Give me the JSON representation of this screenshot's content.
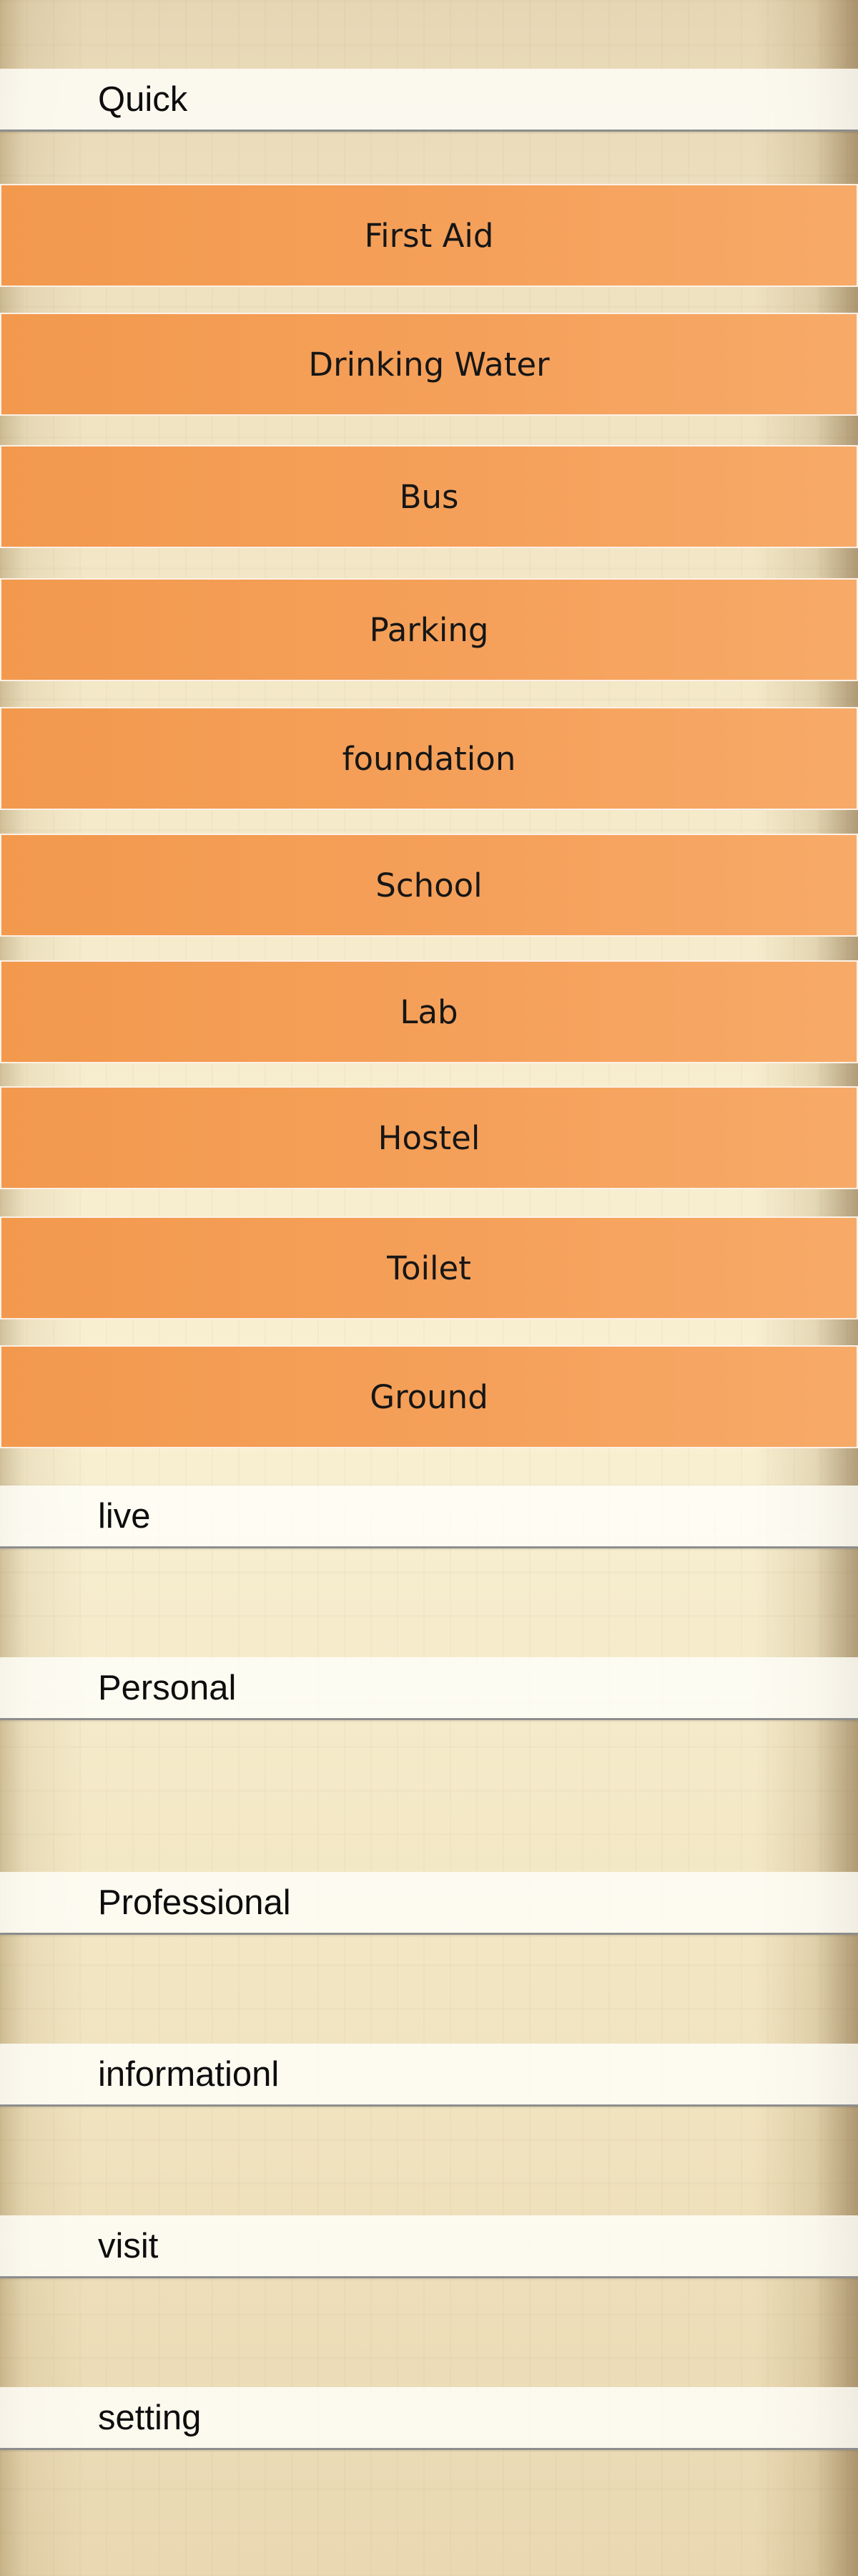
{
  "quick_header": {
    "label": "Quick"
  },
  "quick_items": [
    {
      "label": "First Aid"
    },
    {
      "label": "Drinking Water"
    },
    {
      "label": "Bus"
    },
    {
      "label": "Parking"
    },
    {
      "label": "foundation"
    },
    {
      "label": "School"
    },
    {
      "label": "Lab"
    },
    {
      "label": "Hostel"
    },
    {
      "label": "Toilet"
    },
    {
      "label": "Ground"
    }
  ],
  "sections": [
    {
      "label": "live"
    },
    {
      "label": "Personal"
    },
    {
      "label": "Professional"
    },
    {
      "label": "informationl"
    },
    {
      "label": "visit"
    },
    {
      "label": "setting"
    }
  ],
  "colors": {
    "button_orange": "#f5a05a",
    "bar_white": "#fffffa",
    "bar_border": "#8d8d8d",
    "text": "#0d0d0d"
  }
}
